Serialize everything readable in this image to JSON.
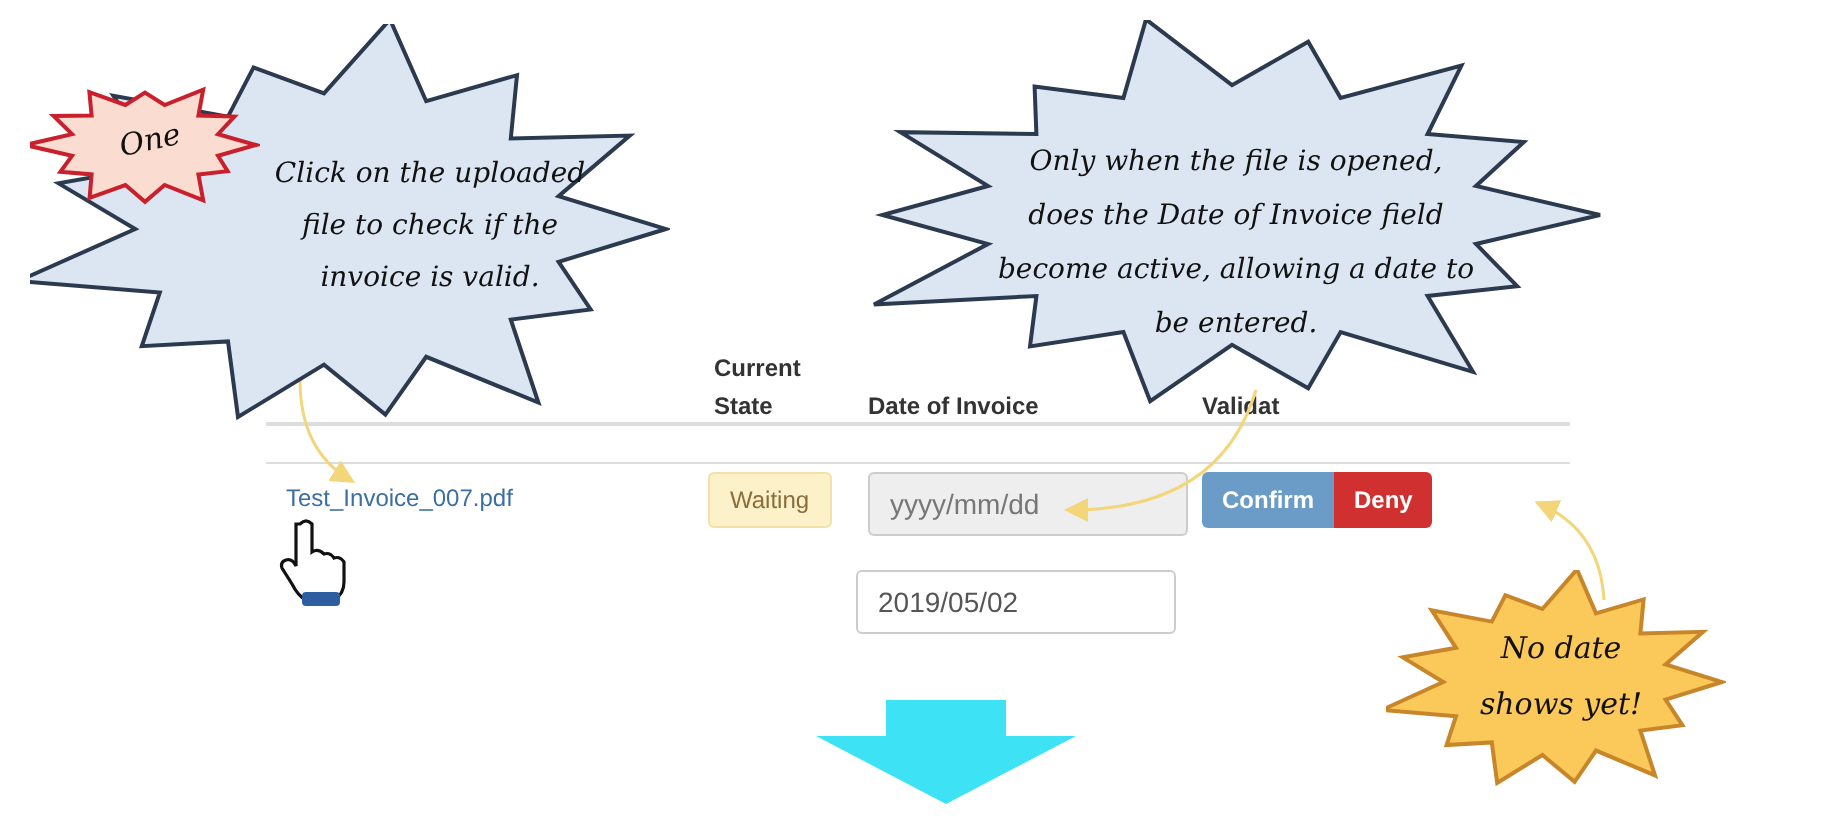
{
  "table": {
    "header": {
      "current_state": "Current State",
      "date_of_invoice": "Date of Invoice",
      "column_4": "Validat"
    },
    "rows": [
      {
        "file": "Test_Invoice_007.pdf",
        "state": "Waiting",
        "date_field": {
          "placeholder": "yyyy/mm/dd",
          "disabled": true
        },
        "buttons": [
          {
            "label": "Confirm",
            "kind": "confirm"
          },
          {
            "label": "Deny",
            "kind": "deny"
          }
        ]
      }
    ],
    "preview_field": {
      "value": "2019/05/02",
      "disabled": false
    }
  },
  "callouts": [
    {
      "kind": "note",
      "text": "Click on the uploaded file to check if the invoice is valid."
    },
    {
      "kind": "step",
      "text": "One"
    },
    {
      "kind": "note",
      "text": "Only when the file is opened, does the Date of Invoice field become active, allowing a date to be entered."
    },
    {
      "kind": "warning",
      "text": "No date shows yet!"
    }
  ]
}
